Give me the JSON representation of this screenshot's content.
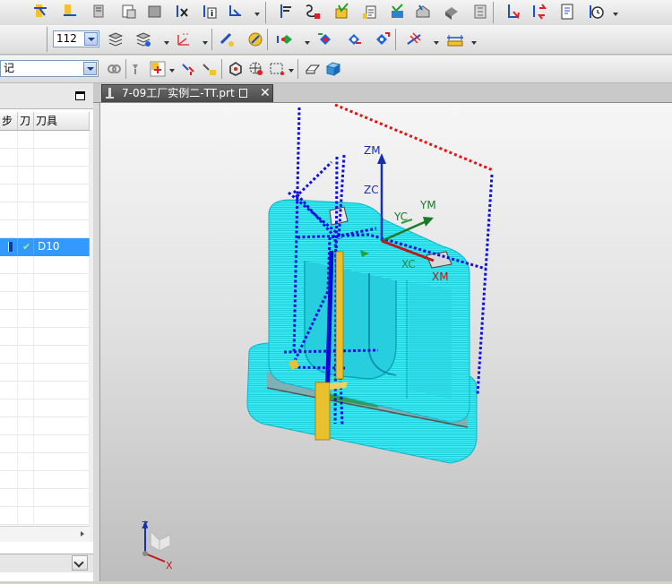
{
  "toolbar": {
    "layer_combo_value": "112",
    "filter_combo_value": "记"
  },
  "navigator": {
    "columns": [
      "步",
      "刀",
      "刀具"
    ],
    "selected_row_tool": "D10"
  },
  "document": {
    "tab_title": "7-09工厂实例二-TT.prt",
    "close_glyph": "✕"
  },
  "axes": {
    "zm": "ZM",
    "zc": "ZC",
    "yc": "YC",
    "ym": "YM",
    "xc": "XC",
    "xm": "XM",
    "triad_z": "Z",
    "triad_x": "X"
  },
  "colors": {
    "part_cyan": "#2de8f0",
    "toolpath_blue": "#1010e0",
    "boundary_red": "#e81010",
    "tool_yellow": "#e8c030",
    "selection_blue": "#3399ff"
  }
}
